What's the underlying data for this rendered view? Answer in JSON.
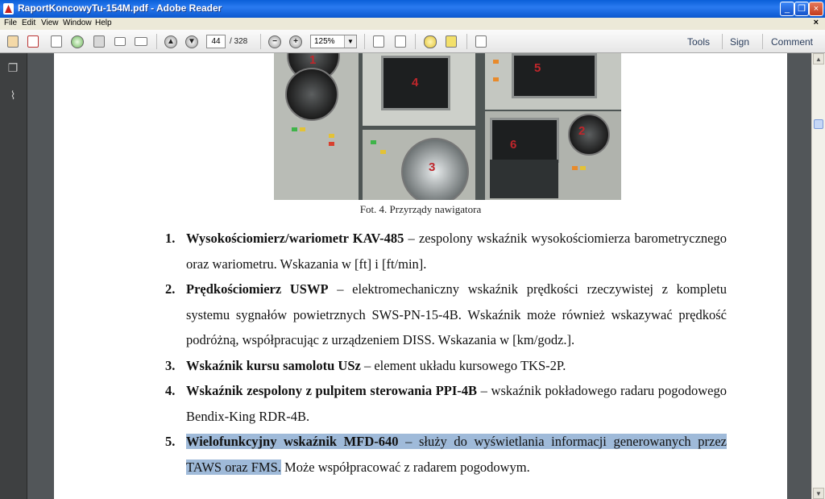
{
  "window": {
    "title": "RaportKoncowyTu-154M.pdf - Adobe Reader",
    "controls": [
      "_",
      "❐",
      "×"
    ]
  },
  "menu": {
    "items": [
      "File",
      "Edit",
      "View",
      "Window",
      "Help"
    ],
    "close_glyph": "×"
  },
  "toolbar": {
    "page_current": "44",
    "page_total": "/ 328",
    "zoom": "125%",
    "links": [
      "Tools",
      "Sign",
      "Comment"
    ],
    "icons": [
      "create-pdf-icon",
      "open-acrobat-icon",
      "edit-icon",
      "cloud-icon",
      "save-icon",
      "print-icon",
      "email-icon",
      "previous-page-icon",
      "next-page-icon",
      "zoom-out-icon",
      "zoom-in-icon",
      "fit-page-icon",
      "fit-width-icon",
      "comment-icon",
      "highlight-icon",
      "fullscreen-icon"
    ]
  },
  "sidebar": {
    "icons": [
      "pages-icon",
      "attachments-icon"
    ]
  },
  "document": {
    "photo_labels": [
      "1",
      "4",
      "5",
      "2",
      "6",
      "3"
    ],
    "caption": "Fot. 4. Przyrządy nawigatora",
    "items": [
      {
        "num": "1.",
        "bold": "Wysokościomierz/wariometr KAV-485",
        "rest": " – zespolony wskaźnik wysokościomierza barometrycznego oraz wariometru. Wskazania w [ft] i [ft/min]."
      },
      {
        "num": "2.",
        "bold": "Prędkościomierz USWP",
        "rest": " – elektromechaniczny wskaźnik prędkości rzeczywistej z kompletu systemu sygnałów powietrznych SWS-PN-15-4B. Wskaźnik może również wskazywać prędkość podróżną, współpracując z urządzeniem DISS. Wskazania w [km/godz.]."
      },
      {
        "num": "3.",
        "bold": "Wskaźnik kursu samolotu USz",
        "rest": " – element układu kursowego TKS-2P."
      },
      {
        "num": "4.",
        "bold": "Wskaźnik zespolony z pulpitem sterowania PPI-4B",
        "rest": " – wskaźnik pokładowego radaru pogodowego Bendix-King RDR-4B."
      },
      {
        "num": "5.",
        "bold": "Wielofunkcyjny wskaźnik MFD-640",
        "rest_highlighted": " – służy do wyświetlania informacji generowanych przez TAWS oraz FMS.",
        "rest_plain": " Może współpracować z radarem pogodowym."
      }
    ]
  },
  "colors": {
    "titlebar": "#0a5fd8",
    "highlight": "#9fbad9",
    "page_bg": "#ffffff",
    "workspace": "#525659"
  }
}
